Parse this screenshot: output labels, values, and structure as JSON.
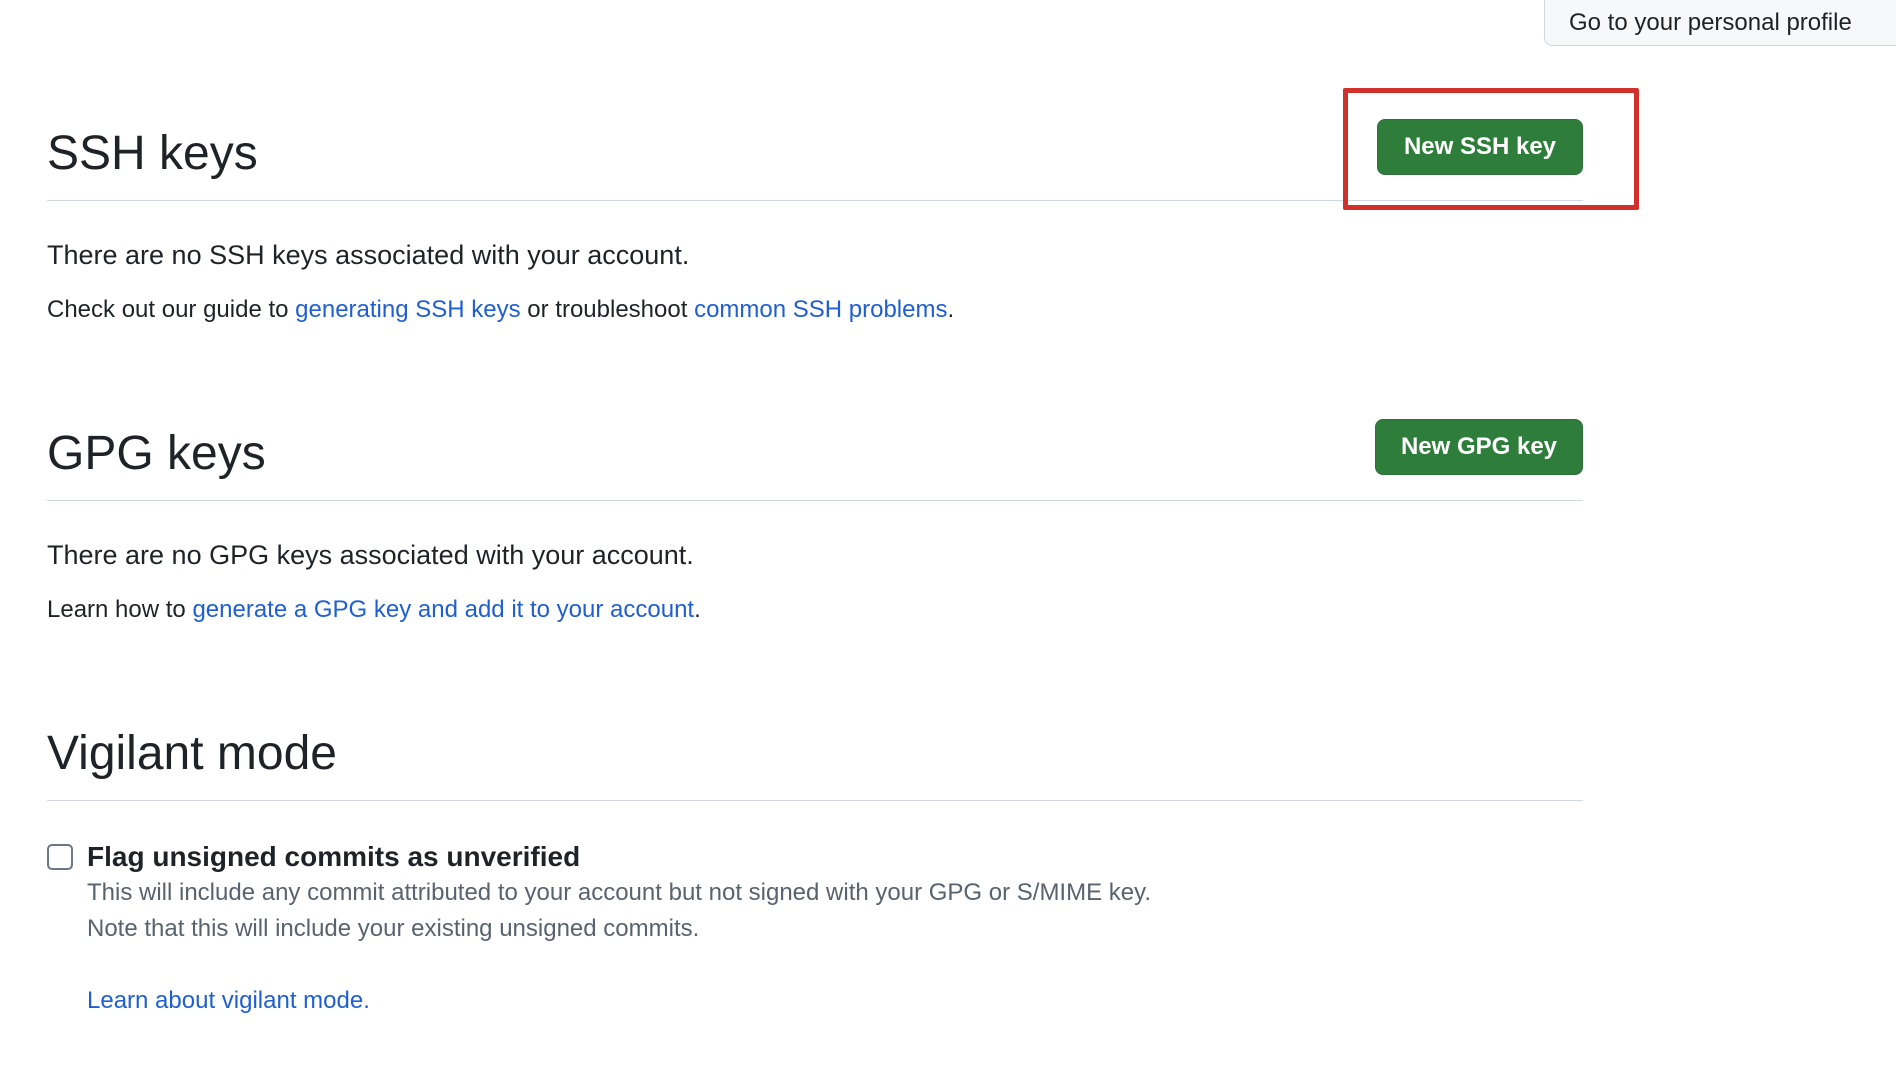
{
  "header": {
    "profile_button_label": "Go to your personal profile"
  },
  "ssh": {
    "title": "SSH keys",
    "new_button_label": "New SSH key",
    "empty_message": "There are no SSH keys associated with your account.",
    "guide_prefix": "Check out our guide to ",
    "guide_link_1": "generating SSH keys",
    "guide_middle": " or troubleshoot ",
    "guide_link_2": "common SSH problems",
    "guide_suffix": "."
  },
  "gpg": {
    "title": "GPG keys",
    "new_button_label": "New GPG key",
    "empty_message": "There are no GPG keys associated with your account.",
    "learn_prefix": "Learn how to ",
    "learn_link": "generate a GPG key and add it to your account",
    "learn_suffix": "."
  },
  "vigilant": {
    "title": "Vigilant mode",
    "checkbox_label": "Flag unsigned commits as unverified",
    "checked": false,
    "note_line_1": "This will include any commit attributed to your account but not signed with your GPG or S/MIME key.",
    "note_line_2": "Note that this will include your existing unsigned commits.",
    "learn_link": "Learn about vigilant mode."
  },
  "colors": {
    "primary_button": "#2f7d3b",
    "link": "#1f5fd1",
    "highlight": "#d0322b",
    "muted_text": "#59636e"
  }
}
